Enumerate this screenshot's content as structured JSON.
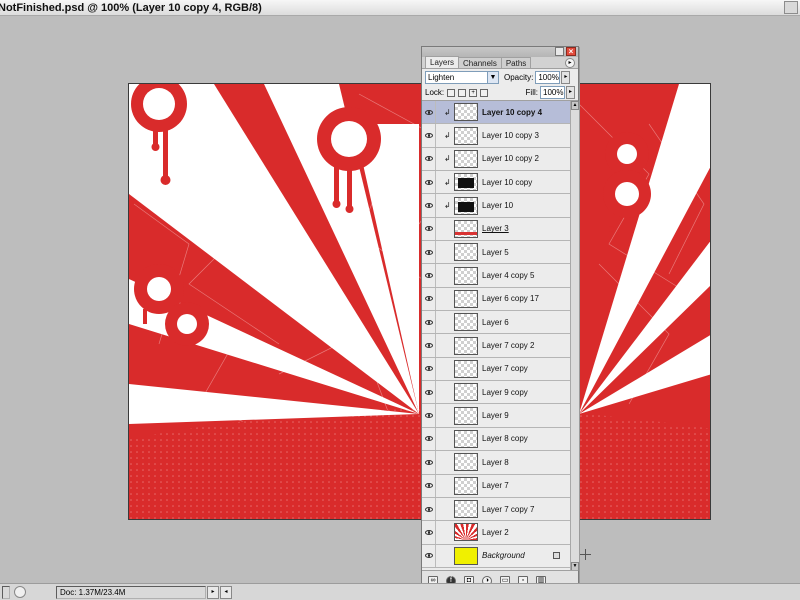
{
  "window": {
    "title": "NotFinished.psd @ 100% (Layer 10 copy 4, RGB/8)"
  },
  "layers_panel": {
    "tabs": [
      {
        "label": "Layers",
        "active": true
      },
      {
        "label": "Channels",
        "active": false
      },
      {
        "label": "Paths",
        "active": false
      }
    ],
    "blend_mode": "Lighten",
    "opacity_label": "Opacity:",
    "opacity_value": "100%",
    "lock_label": "Lock:",
    "fill_label": "Fill:",
    "fill_value": "100%",
    "layers": [
      {
        "name": "Layer 10 copy 4",
        "selected": true,
        "clipped": true,
        "thumb": "lines"
      },
      {
        "name": "Layer 10 copy 3",
        "selected": false,
        "clipped": true,
        "thumb": "lines"
      },
      {
        "name": "Layer 10 copy 2",
        "selected": false,
        "clipped": true,
        "thumb": "lines"
      },
      {
        "name": "Layer 10 copy",
        "selected": false,
        "clipped": true,
        "thumb": "dark"
      },
      {
        "name": "Layer 10",
        "selected": false,
        "clipped": true,
        "thumb": "dark"
      },
      {
        "name": "Layer 3",
        "selected": false,
        "clipped": false,
        "thumb": "redstripe",
        "underline": true
      },
      {
        "name": "Layer 5",
        "selected": false,
        "clipped": false,
        "thumb": "transparent"
      },
      {
        "name": "Layer 4 copy 5",
        "selected": false,
        "clipped": false,
        "thumb": "transparent"
      },
      {
        "name": "Layer 6 copy 17",
        "selected": false,
        "clipped": false,
        "thumb": "transparent"
      },
      {
        "name": "Layer 6",
        "selected": false,
        "clipped": false,
        "thumb": "transparent"
      },
      {
        "name": "Layer 7 copy 2",
        "selected": false,
        "clipped": false,
        "thumb": "transparent"
      },
      {
        "name": "Layer 7 copy",
        "selected": false,
        "clipped": false,
        "thumb": "transparent"
      },
      {
        "name": "Layer 9 copy",
        "selected": false,
        "clipped": false,
        "thumb": "transparent"
      },
      {
        "name": "Layer 9",
        "selected": false,
        "clipped": false,
        "thumb": "transparent"
      },
      {
        "name": "Layer 8 copy",
        "selected": false,
        "clipped": false,
        "thumb": "transparent"
      },
      {
        "name": "Layer 8",
        "selected": false,
        "clipped": false,
        "thumb": "transparent"
      },
      {
        "name": "Layer 7",
        "selected": false,
        "clipped": false,
        "thumb": "transparent"
      },
      {
        "name": "Layer 7 copy 7",
        "selected": false,
        "clipped": false,
        "thumb": "transparent"
      },
      {
        "name": "Layer 2",
        "selected": false,
        "clipped": false,
        "thumb": "sunburst"
      },
      {
        "name": "Background",
        "selected": false,
        "clipped": false,
        "thumb": "yellow",
        "italic": true,
        "locked": true
      }
    ],
    "footer_buttons": [
      "link-icon",
      "layer-style-icon",
      "mask-icon",
      "adjustment-icon",
      "group-icon",
      "new-layer-icon",
      "trash-icon"
    ]
  },
  "status_bar": {
    "doc_info": "Doc: 1.37M/23.4M"
  },
  "colors": {
    "canvas_red": "#d92b2b",
    "workspace_gray": "#bdbdbd",
    "selected_layer": "#b6bdd8",
    "background_thumb": "#f0f000"
  }
}
